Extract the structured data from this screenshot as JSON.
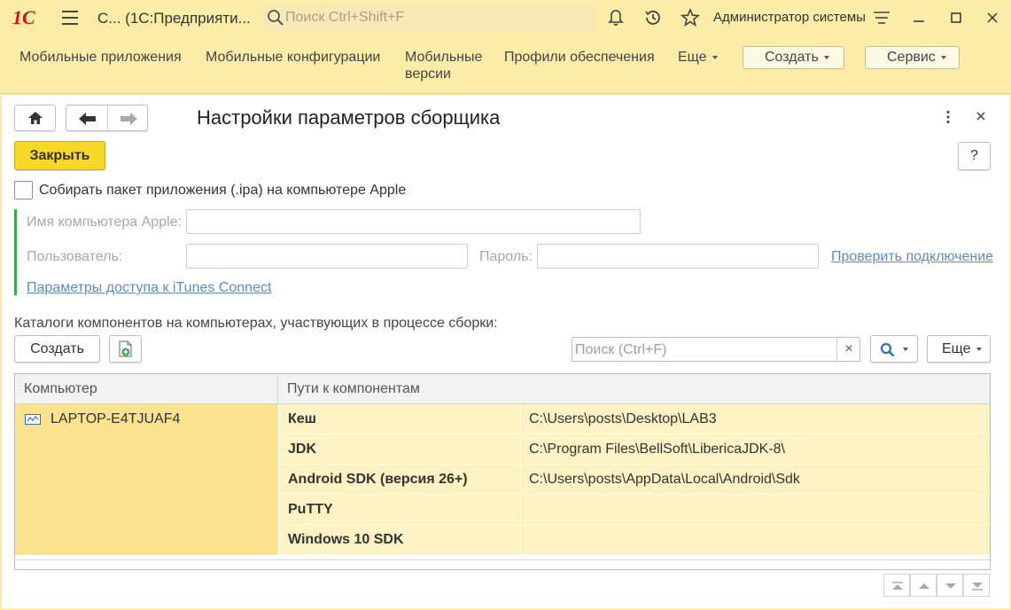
{
  "titlebar": {
    "logo": "1С",
    "window_title": "С...  (1С:Предприяти...",
    "search_placeholder": "Поиск Ctrl+Shift+F",
    "user_name": "Администратор системы"
  },
  "menu": {
    "items": [
      "Мобильные приложения",
      "Мобильные конфигурации",
      "Мобильные\nверсии",
      "Профили обеспечения"
    ],
    "more_label": "Еще",
    "create_label": "Создать",
    "service_label": "Сервис"
  },
  "form": {
    "title": "Настройки параметров сборщика",
    "close_button": "Закрыть",
    "help_button": "?",
    "apple_checkbox_label": "Собирать пакет приложения (.ipa) на компьютере Apple",
    "apple_checkbox_checked": false,
    "apple_host_label": "Имя компьютера Apple:",
    "apple_host_value": "",
    "user_label": "Пользователь:",
    "user_value": "",
    "password_label": "Пароль:",
    "password_value": "",
    "check_connection_link": "Проверить подключение",
    "itunes_link": "Параметры доступа к iTunes Connect"
  },
  "catalog": {
    "label": "Каталоги компонентов на компьютерах, участвующих в процессе сборки:",
    "create_button": "Создать",
    "search_placeholder": "Поиск (Ctrl+F)",
    "clear_glyph": "×",
    "more_label": "Еще",
    "columns": [
      "Компьютер",
      "Пути к компонентам"
    ],
    "computer": "LAPTOP-E4TJUAF4",
    "rows": [
      {
        "name": "Кеш",
        "path": "C:\\Users\\posts\\Desktop\\LAB3"
      },
      {
        "name": "JDK",
        "path": "C:\\Program Files\\BellSoft\\LibericaJDK-8\\"
      },
      {
        "name": "Android SDK (версия 26+)",
        "path": "C:\\Users\\posts\\AppData\\Local\\Android\\Sdk"
      },
      {
        "name": "PuTTY",
        "path": ""
      },
      {
        "name": "Windows 10 SDK",
        "path": ""
      }
    ]
  },
  "colors": {
    "accent_yellow": "#f7d728",
    "header_bg": "#fbeda8",
    "selection": "#fbe28e",
    "group_bar": "#3aa757",
    "link": "#5f8bc2"
  }
}
